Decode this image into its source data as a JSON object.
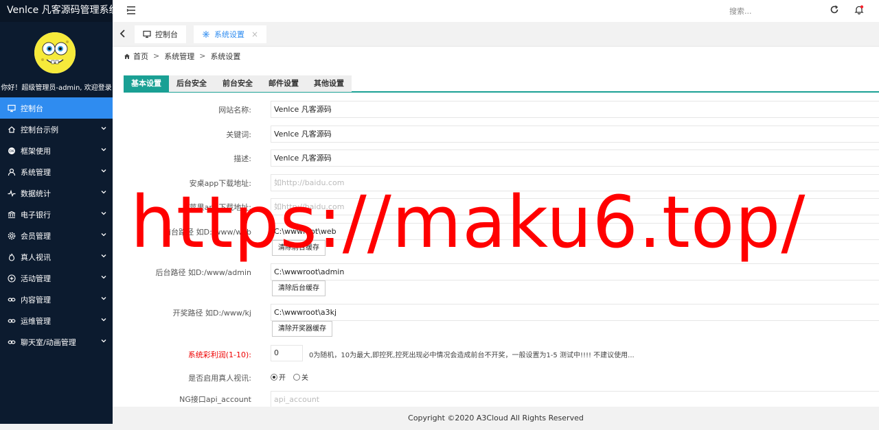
{
  "app": {
    "title": "Venlce 凡客源码管理系统"
  },
  "user": {
    "greeting": "你好！超级管理员-admin, 欢迎登录"
  },
  "sidebar": {
    "items": [
      {
        "label": "控制台",
        "icon": "monitor-icon",
        "active": true
      },
      {
        "label": "控制台示例",
        "icon": "home-icon"
      },
      {
        "label": "框架使用",
        "icon": "ok-icon"
      },
      {
        "label": "系统管理",
        "icon": "user-icon"
      },
      {
        "label": "数据统计",
        "icon": "pulse-icon"
      },
      {
        "label": "电子银行",
        "icon": "bank-icon"
      },
      {
        "label": "会员管理",
        "icon": "gear-icon"
      },
      {
        "label": "真人视讯",
        "icon": "fire-icon"
      },
      {
        "label": "活动管理",
        "icon": "plus-circle-icon"
      },
      {
        "label": "内容管理",
        "icon": "link-icon"
      },
      {
        "label": "运维管理",
        "icon": "link-icon"
      },
      {
        "label": "聊天室/动画管理",
        "icon": "link-icon"
      }
    ]
  },
  "topbar": {
    "search_placeholder": "搜索..."
  },
  "tabs": [
    {
      "label": "控制台",
      "icon": "monitor-icon"
    },
    {
      "label": "系统设置",
      "icon": "gear-icon",
      "active": true,
      "close": "×"
    }
  ],
  "breadcrumb": {
    "items": [
      "首页",
      "系统管理",
      "系统设置"
    ],
    "sep": ">"
  },
  "settings_tabs": [
    "基本设置",
    "后台安全",
    "前台安全",
    "邮件设置",
    "其他设置"
  ],
  "form": {
    "site_name_label": "网站名称:",
    "site_name_value": "Venlce 凡客源码",
    "keywords_label": "关键词:",
    "keywords_value": "Venlce 凡客源码",
    "desc_label": "描述:",
    "desc_value": "Venlce 凡客源码",
    "android_label": "安桌app下载地址:",
    "android_placeholder": "如http://baidu.com",
    "ios_label": "苹果app下载地址:",
    "ios_placeholder": "如http://baidu.com",
    "front_path_label": "前台路径 如D:/www/web",
    "front_path_value": "C:\\wwwroot\\web",
    "front_cache_btn": "清除前台缓存",
    "admin_path_label": "后台路径 如D:/www/admin",
    "admin_path_value": "C:\\wwwroot\\admin",
    "admin_cache_btn": "清除后台缓存",
    "lottery_path_label": "开奖路径 如D:/www/kj",
    "lottery_path_value": "C:\\wwwroot\\a3kj",
    "lottery_cache_btn": "清除开奖器缓存",
    "profit_label": "系统彩利润(1-10):",
    "profit_value": "0",
    "profit_hint": "0为随机，10为最大,即控死,控死出现必中情况会造成前台不开奖，一般设置为1-5 测试中!!!! 不建议使用...",
    "live_label": "是否启用真人视讯:",
    "live_on": "开",
    "live_off": "关",
    "ng_label": "NG接口api_account",
    "ng_placeholder": "api_account"
  },
  "footer": {
    "copyright": "Copyright ©2020 A3Cloud All Rights Reserved"
  },
  "watermark": {
    "text": "https://maku6.top/"
  },
  "colors": {
    "sidebar_bg": "#0c1b2f",
    "active_menu": "#2f8cf0",
    "tab_accent": "#1aa094",
    "warning_text": "#e00000"
  }
}
